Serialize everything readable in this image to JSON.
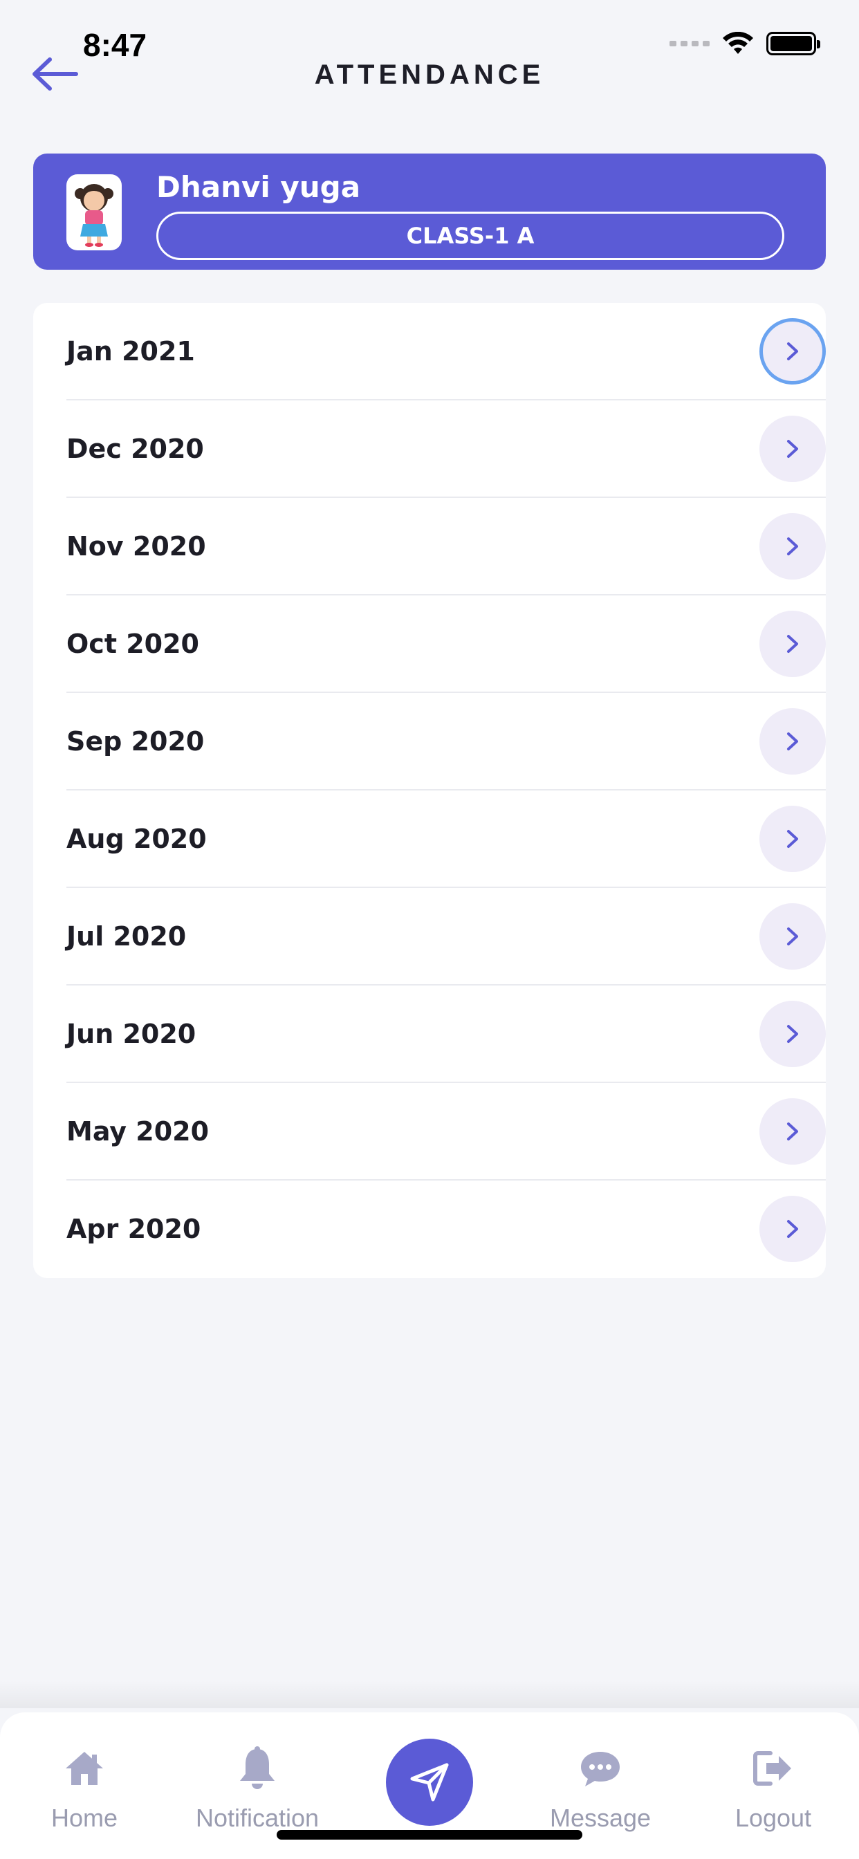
{
  "status_bar": {
    "time": "8:47"
  },
  "header": {
    "title": "ATTENDANCE"
  },
  "student": {
    "name": "Dhanvi yuga",
    "class": "CLASS-1 A"
  },
  "months": [
    {
      "label": "Jan 2021"
    },
    {
      "label": "Dec 2020"
    },
    {
      "label": "Nov 2020"
    },
    {
      "label": "Oct 2020"
    },
    {
      "label": "Sep 2020"
    },
    {
      "label": "Aug 2020"
    },
    {
      "label": "Jul 2020"
    },
    {
      "label": "Jun 2020"
    },
    {
      "label": "May 2020"
    },
    {
      "label": "Apr 2020"
    }
  ],
  "nav": {
    "home": "Home",
    "notification": "Notification",
    "message": "Message",
    "logout": "Logout"
  },
  "colors": {
    "primary": "#5b5bd6",
    "background": "#f4f5f9",
    "chevron_bg": "#efecf8",
    "nav_icon": "#a7a9c8"
  }
}
